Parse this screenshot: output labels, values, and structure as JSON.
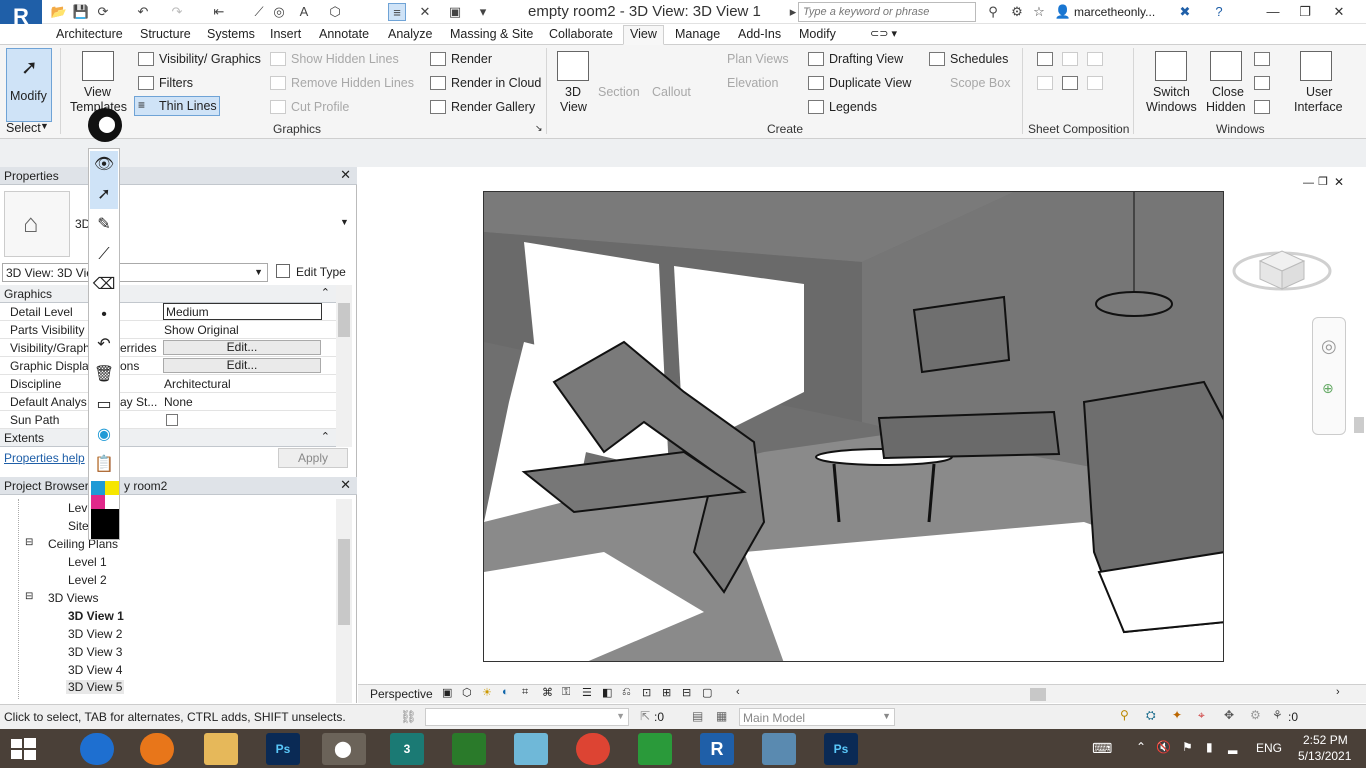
{
  "app": {
    "logo_letter": "R",
    "document_title": "empty room2 - 3D View: 3D View 1",
    "search_placeholder": "Type a keyword or phrase",
    "user": "marcetheonly..."
  },
  "tabs": [
    "Architecture",
    "Structure",
    "Systems",
    "Insert",
    "Annotate",
    "Analyze",
    "Massing & Site",
    "Collaborate",
    "View",
    "Manage",
    "Add-Ins",
    "Modify"
  ],
  "active_tab": "View",
  "ribbon": {
    "modify": "Modify",
    "select": "Select",
    "view_templates": [
      "View",
      "Templates"
    ],
    "vis_graphics": "Visibility/ Graphics",
    "filters": "Filters",
    "thin_lines": "Thin Lines",
    "show_hidden": "Show Hidden Lines",
    "remove_hidden": "Remove Hidden Lines",
    "cut_profile": "Cut Profile",
    "render": "Render",
    "render_cloud": "Render in Cloud",
    "render_gallery": "Render Gallery",
    "graphics_label": "Graphics",
    "view3d": [
      "3D",
      "View"
    ],
    "section": "Section",
    "callout": "Callout",
    "plan_views": "Plan Views",
    "elevation": "Elevation",
    "drafting": "Drafting View",
    "duplicate": "Duplicate View",
    "legends": "Legends",
    "schedules": "Schedules",
    "scope_box": "Scope Box",
    "create_label": "Create",
    "sheet_comp_label": "Sheet Composition",
    "switch_windows": [
      "Switch",
      "Windows"
    ],
    "close_hidden": [
      "Close",
      "Hidden"
    ],
    "user_interface": [
      "User",
      "Interface"
    ],
    "windows_label": "Windows"
  },
  "properties": {
    "title": "Properties",
    "type_short": "3D",
    "selector": "3D View: 3D Vie",
    "edit_type": "Edit Type",
    "section_graphics": "Graphics",
    "section_extents": "Extents",
    "rows": [
      {
        "k": "Detail Level",
        "v": "Medium"
      },
      {
        "k": "Parts Visibility",
        "v": "Show Original"
      },
      {
        "k": "Visibility/Graph",
        "k2": "errides",
        "v": "Edit..."
      },
      {
        "k": "Graphic Displa",
        "k2": "ons",
        "v": "Edit..."
      },
      {
        "k": "Discipline",
        "v": "Architectural"
      },
      {
        "k": "Default Analys",
        "k2": "ay St...",
        "v": "None"
      },
      {
        "k": "Sun Path",
        "v": ""
      }
    ],
    "help": "Properties help",
    "apply": "Apply"
  },
  "browser": {
    "title": "Project Browser",
    "title_tail": "y room2",
    "items": [
      {
        "t": "Lev"
      },
      {
        "t": "Site"
      },
      {
        "t": "Ceiling Plans"
      },
      {
        "t": "Level 1"
      },
      {
        "t": "Level 2"
      },
      {
        "t": "3D Views"
      },
      {
        "t": "3D View 1"
      },
      {
        "t": "3D View 2"
      },
      {
        "t": "3D View 3"
      },
      {
        "t": "3D View 4"
      },
      {
        "t": "3D View 5"
      }
    ]
  },
  "viewbar": {
    "mode": "Perspective"
  },
  "status": {
    "hint": "Click to select, TAB for alternates, CTRL adds, SHIFT unselects.",
    "sel_count": ":0",
    "model": "Main Model",
    "filter_count": ":0"
  },
  "taskbar": {
    "lang": "ENG",
    "time": "2:52 PM",
    "date": "5/13/2021"
  },
  "colors": {
    "ribbon_bg": "#f5f5f5",
    "active_blue": "#cfe3f7",
    "taskbar": "#4a4038",
    "revit_blue": "#1f5fa8"
  }
}
